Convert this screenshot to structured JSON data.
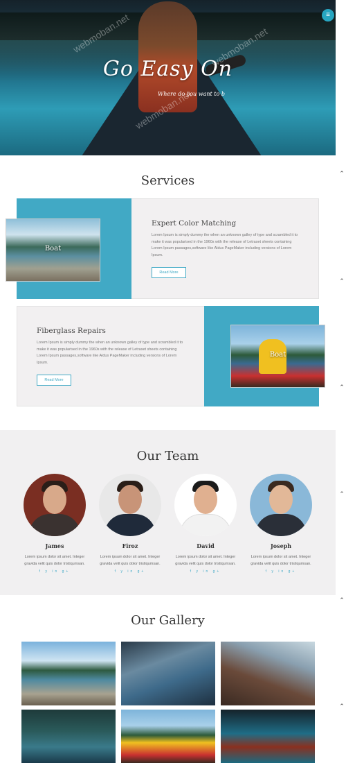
{
  "hero": {
    "title": "Go Easy On",
    "subtitle": "Where do you want to b",
    "menu_icon": "hamburger-icon"
  },
  "services": {
    "heading": "Services",
    "items": [
      {
        "title": "Expert Color Matching",
        "text": "Lorem Ipsum is simply dummy the when an unknown galley of type and scrambled it to make it was popularised in the 1960s with the release of Letraset sheets containing Lorem Ipsum passages,software like Aldus PageMaker including versions of Lorem Ipsum.",
        "image_label": "Boat",
        "button": "Read More"
      },
      {
        "title": "Fiberglass Repairs",
        "text": "Lorem Ipsum is simply dummy the when an unknown galley of type and scrambled it to make it was popularised in the 1960s with the release of Letraset sheets containing Lorem Ipsum passages,software like Aldus PageMaker including versions of Lorem Ipsum.",
        "image_label": "Boat",
        "button": "Read More"
      }
    ]
  },
  "team": {
    "heading": "Our Team",
    "members": [
      {
        "name": "James",
        "bio": "Lorem ipsum dolor sit amet. Integer gravida velit quis dolor tristiqumsan.",
        "social": "f y in g+"
      },
      {
        "name": "Firoz",
        "bio": "Lorem ipsum dolor sit amet. Integer gravida velit quis dolor tristiqumsan.",
        "social": "f y in g+"
      },
      {
        "name": "David",
        "bio": "Lorem ipsum dolor sit amet. Integer gravida velit quis dolor tristiqumsan.",
        "social": "f y in g+"
      },
      {
        "name": "Joseph",
        "bio": "Lorem ipsum dolor sit amet. Integer gravida velit quis dolor tristiqumsan.",
        "social": "f y in g+"
      }
    ]
  },
  "gallery": {
    "heading": "Our Gallery"
  },
  "watermark": "webmoban.net",
  "colors": {
    "accent": "#41a9c5",
    "card_bg": "#f2f0f1"
  }
}
